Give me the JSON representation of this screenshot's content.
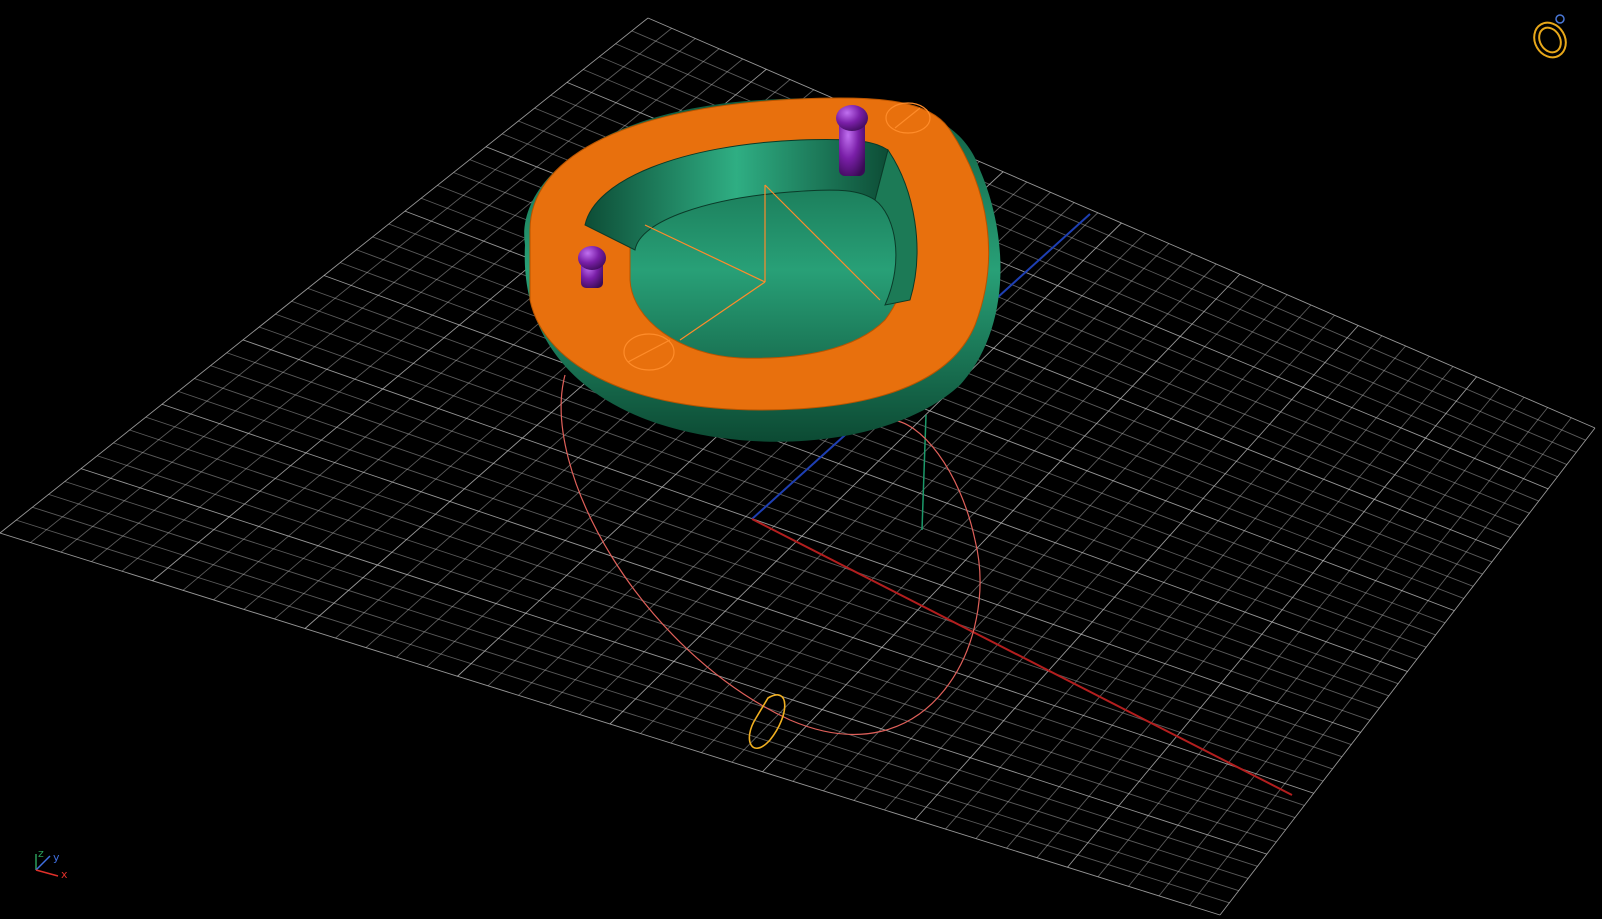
{
  "app": {
    "background": "#000000"
  },
  "viewport": {
    "grid_color": "#c8c8c8",
    "axis_x_color": "#b31e1e",
    "axis_y_color": "#1e3fb3",
    "axis_z_color": "#1b9a6a",
    "model": {
      "outer_band_color": "#1f8a62",
      "top_band_color": "#e8700d",
      "prong_color": "#7a1fa8",
      "construction_line_color": "#ff8c2a",
      "profile_curve_color": "#e0605a",
      "cross_section_color": "#f2b020"
    }
  },
  "nav_widget": {
    "icon": "ring-view-icon",
    "color": "#e8a81a"
  },
  "axis_triad": {
    "z_label": "z",
    "y_label": "y",
    "x_label": "x",
    "z_color": "#2a9d5a",
    "y_color": "#3f6fe0",
    "x_color": "#e0302a"
  }
}
